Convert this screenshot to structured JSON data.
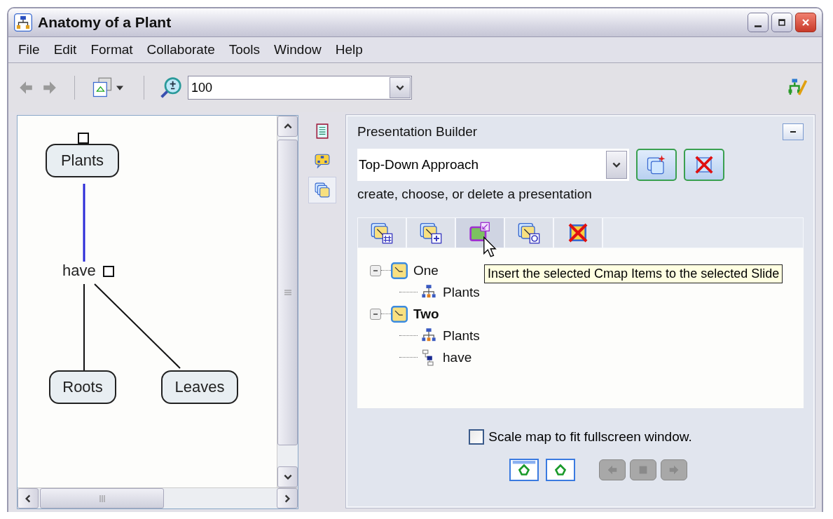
{
  "window": {
    "title": "Anatomy of a Plant"
  },
  "menu": [
    "File",
    "Edit",
    "Format",
    "Collaborate",
    "Tools",
    "Window",
    "Help"
  ],
  "toolbar": {
    "zoom": "100"
  },
  "map": {
    "concepts": [
      {
        "label": "Plants",
        "selected": true
      },
      {
        "label": "Roots",
        "selected": false
      },
      {
        "label": "Leaves",
        "selected": false
      }
    ],
    "linking_phrase": {
      "label": "have",
      "selected": true
    },
    "lines": [
      {
        "selected": true
      },
      {
        "selected": false
      },
      {
        "selected": false
      }
    ]
  },
  "side_tabs": [
    {
      "kind": "list",
      "selected": false
    },
    {
      "kind": "map",
      "selected": false
    },
    {
      "kind": "slides",
      "selected": true
    }
  ],
  "panel": {
    "title": "Presentation Builder",
    "presentation": "Top-Down Approach",
    "hint": "create, choose, or delete a presentation",
    "slide_tools": [
      {
        "kind": "add-all",
        "hovered": false
      },
      {
        "kind": "add",
        "hovered": false
      },
      {
        "kind": "insert",
        "hovered": true
      },
      {
        "kind": "update",
        "hovered": false
      },
      {
        "kind": "delete",
        "hovered": false
      }
    ],
    "tooltip": "Insert the selected Cmap Items to the selected Slide",
    "slides": [
      {
        "label": "One",
        "selected": false,
        "expanded": true,
        "children": [
          {
            "label": "Plants",
            "kind": "concept"
          }
        ]
      },
      {
        "label": "Two",
        "selected": true,
        "expanded": true,
        "children": [
          {
            "label": "Plants",
            "kind": "concept"
          },
          {
            "label": "have",
            "kind": "link"
          }
        ]
      }
    ],
    "scale_option": {
      "label": "Scale map to fit fullscreen window.",
      "checked": false
    },
    "playback": [
      {
        "kind": "window",
        "disabled": false
      },
      {
        "kind": "fullscreen",
        "disabled": false
      },
      {
        "kind": "previous",
        "disabled": true
      },
      {
        "kind": "stop",
        "disabled": true
      },
      {
        "kind": "next",
        "disabled": true
      }
    ]
  }
}
